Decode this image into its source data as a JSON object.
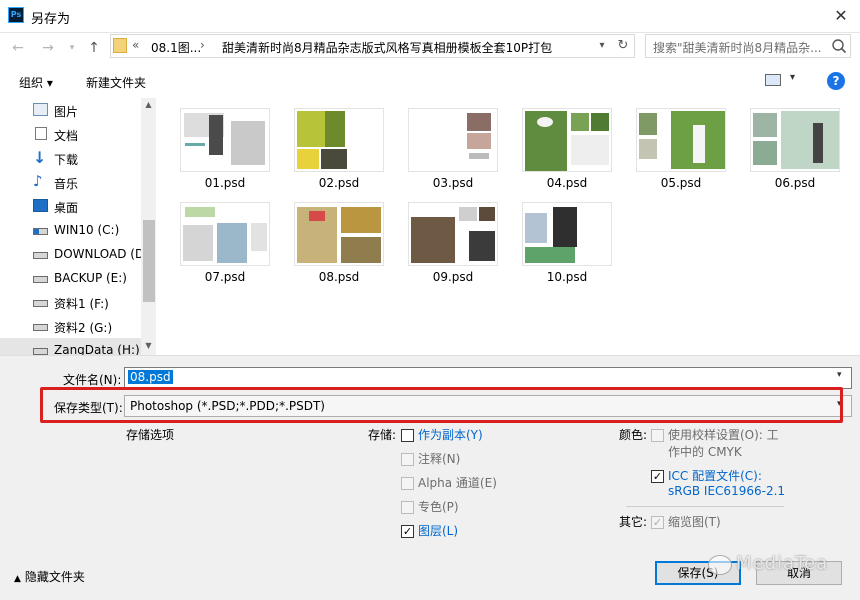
{
  "window": {
    "title": "另存为",
    "app_icon": "Ps"
  },
  "address": {
    "chevron": "«",
    "segment1": "08.1图...",
    "arrow": "›",
    "segment2": "甜美清新时尚8月精品杂志版式风格写真相册模板全套10P打包"
  },
  "search": {
    "placeholder": "搜索\"甜美清新时尚8月精品杂..."
  },
  "toolbar": {
    "organize": "组织 ▾",
    "new_folder": "新建文件夹",
    "help": "?"
  },
  "sidebar": {
    "items": [
      {
        "label": "图片",
        "icon": "pictures-icon"
      },
      {
        "label": "文档",
        "icon": "documents-icon"
      },
      {
        "label": "下载",
        "icon": "download-icon"
      },
      {
        "label": "音乐",
        "icon": "music-icon"
      },
      {
        "label": "桌面",
        "icon": "desktop-icon"
      },
      {
        "label": "WIN10 (C:)",
        "icon": "drive-icon"
      },
      {
        "label": "DOWNLOAD (D",
        "icon": "drive-icon"
      },
      {
        "label": "BACKUP (E:)",
        "icon": "drive-icon"
      },
      {
        "label": "资料1 (F:)",
        "icon": "drive-icon"
      },
      {
        "label": "资料2 (G:)",
        "icon": "drive-icon"
      },
      {
        "label": "ZangData (H:)",
        "icon": "drive-icon"
      }
    ]
  },
  "files": [
    "01.psd",
    "02.psd",
    "03.psd",
    "04.psd",
    "05.psd",
    "06.psd",
    "07.psd",
    "08.psd",
    "09.psd",
    "10.psd"
  ],
  "form": {
    "filename_label": "文件名(N):",
    "filename_value": "08.psd",
    "filetype_label": "保存类型(T):",
    "filetype_value": "Photoshop (*.PSD;*.PDD;*.PSDT)"
  },
  "options": {
    "section_label": "存储选项",
    "storage_label": "存储:",
    "as_copy": "作为副本(Y)",
    "notes": "注释(N)",
    "alpha": "Alpha 通道(E)",
    "spot": "专色(P)",
    "layers": "图层(L)",
    "color_label": "颜色:",
    "use_proof": "使用校样设置(O): 工",
    "use_proof_2": "作中的 CMYK",
    "icc": "ICC 配置文件(C):",
    "icc_2": "sRGB IEC61966-2.1",
    "other_label": "其它:",
    "thumbnail": "缩览图(T)"
  },
  "footer": {
    "hide_folders": "隐藏文件夹",
    "save": "保存(S)",
    "cancel": "取消"
  },
  "watermark": "MediaTea",
  "colors": {
    "accent": "#0078d7",
    "highlight_box": "#d9201e",
    "link": "#0066cc"
  }
}
